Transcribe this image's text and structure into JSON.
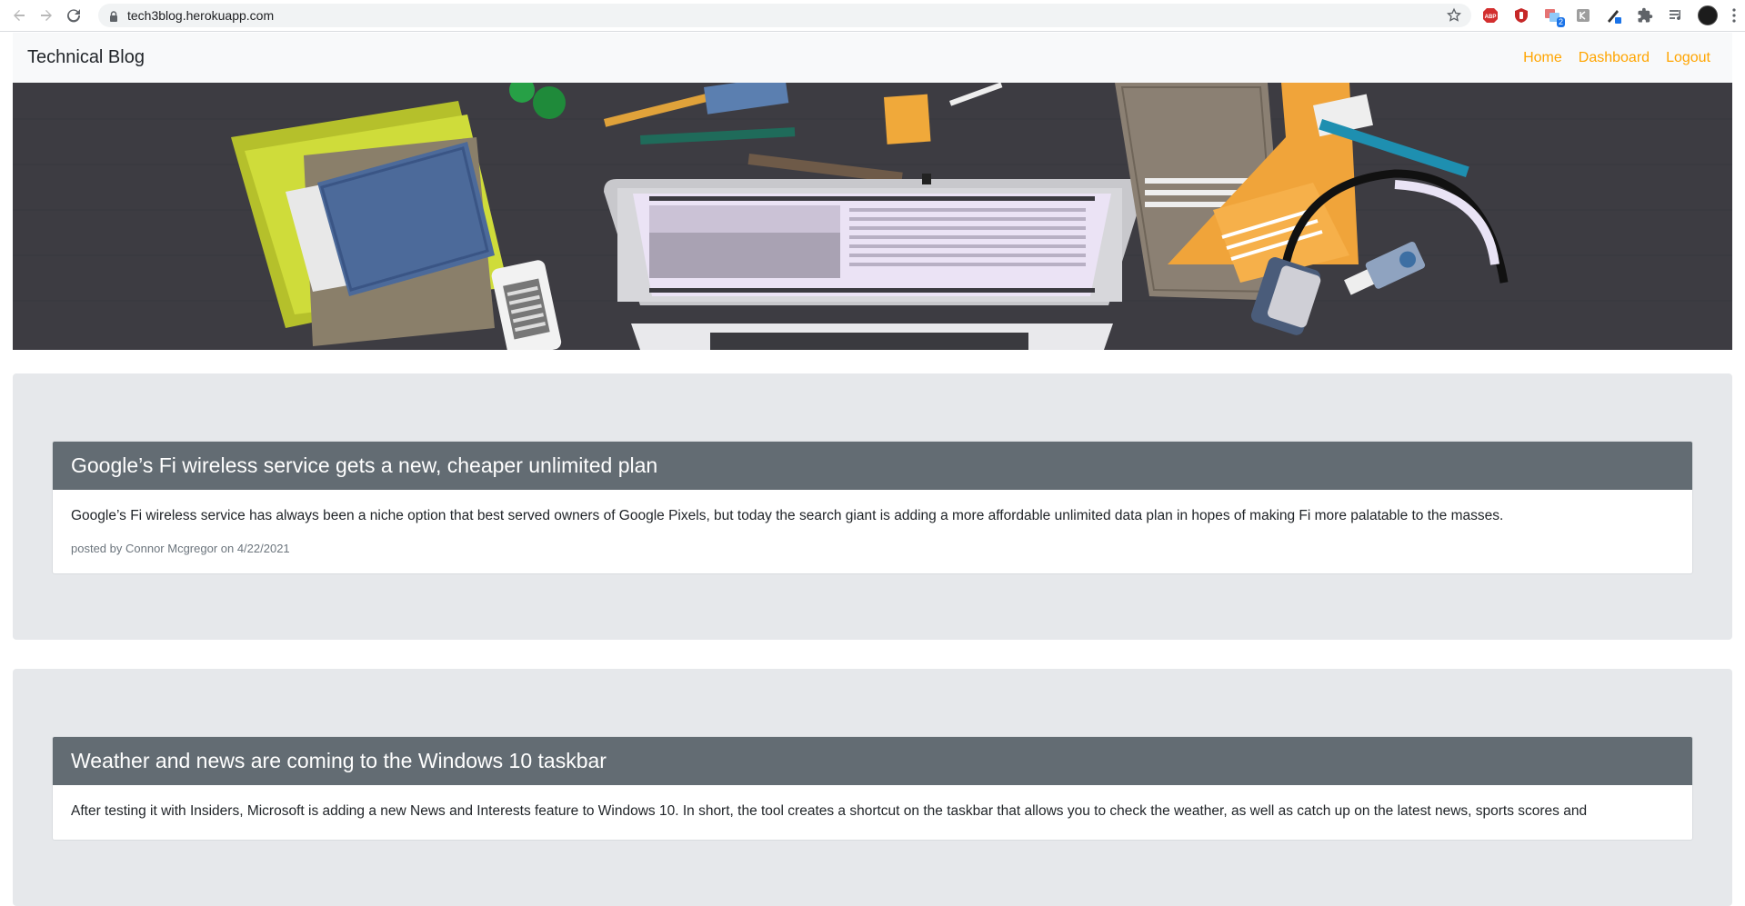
{
  "browser": {
    "url": "tech3blog.herokuapp.com",
    "extension_badge": "2",
    "icons": [
      "back-icon",
      "forward-icon",
      "reload-icon",
      "lock-icon",
      "star-icon",
      "adblock-icon",
      "ublock-icon",
      "translate-icon",
      "ext-icon",
      "pen-icon",
      "puzzle-icon",
      "media-icon",
      "profile-avatar",
      "menu-icon"
    ]
  },
  "navbar": {
    "brand": "Technical Blog",
    "links": [
      "Home",
      "Dashboard",
      "Logout"
    ]
  },
  "posts": [
    {
      "title": "Google’s Fi wireless service gets a new, cheaper unlimited plan",
      "body": "Google’s Fi wireless service has always been a niche option that best served owners of Google Pixels, but today the search giant is adding a more affordable unlimited data plan in hopes of making Fi more palatable to the masses.",
      "meta": "posted by Connor Mcgregor on 4/22/2021"
    },
    {
      "title": "Weather and news are coming to the Windows 10 taskbar",
      "body": "After testing it with Insiders, Microsoft is adding a new News and Interests feature to Windows 10. In short, the tool creates a shortcut on the taskbar that allows you to check the weather, as well as catch up on the latest news, sports scores and"
    }
  ],
  "colors": {
    "nav_link": "#ffa500",
    "card_header": "#636c73",
    "section_bg": "#e6e8eb"
  }
}
